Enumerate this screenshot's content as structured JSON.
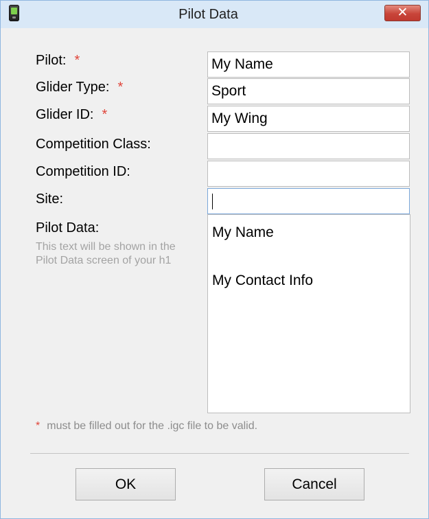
{
  "window": {
    "title": "Pilot Data",
    "close_symbol": "✕"
  },
  "labels": {
    "pilot": "Pilot:",
    "glider_type": "Glider Type:",
    "glider_id": "Glider ID:",
    "competition_class": "Competition Class:",
    "competition_id": "Competition ID:",
    "site": "Site:",
    "pilot_data": "Pilot Data:",
    "pilot_data_hint": "This text will be shown in the Pilot Data screen of your h1",
    "required_marker": "*"
  },
  "fields": {
    "pilot": "My Name",
    "glider_type": "Sport",
    "glider_id": "My Wing",
    "competition_class": "",
    "competition_id": "",
    "site": ""
  },
  "pilot_data_text": {
    "line1": "My Name",
    "line2": "",
    "line3": "My Contact Info"
  },
  "footnote": {
    "star": "*",
    "text": "must be filled out for the .igc file to be valid."
  },
  "buttons": {
    "ok": "OK",
    "cancel": "Cancel"
  },
  "icons": {
    "app": "handheld-device-icon",
    "close": "close-icon"
  },
  "colors": {
    "required": "#e0453a",
    "close_button": "#c8453a",
    "titlebar": "#d9e8f7",
    "hint_text": "#a3a3a3"
  }
}
